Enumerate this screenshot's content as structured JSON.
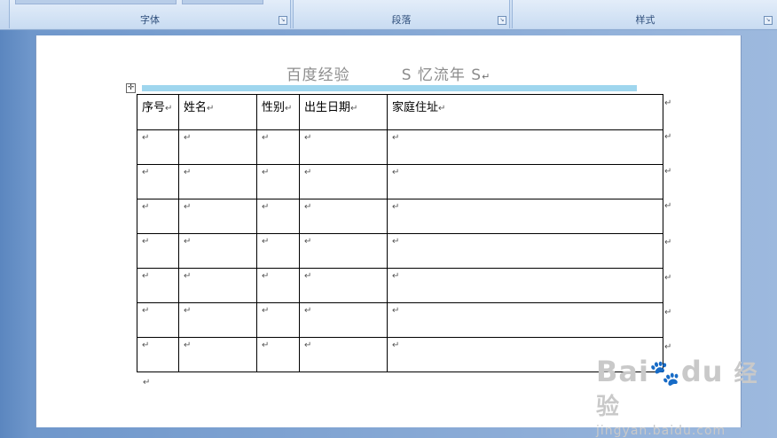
{
  "ribbon": {
    "groups": [
      {
        "label": "字体"
      },
      {
        "label": "段落"
      },
      {
        "label": "样式"
      }
    ]
  },
  "document": {
    "title_left": "百度经验",
    "title_right": "S 忆流年 S",
    "paragraph_mark": "↵",
    "table": {
      "headers": [
        "序号",
        "姓名",
        "性别",
        "出生日期",
        "家庭住址"
      ],
      "rows": 7
    }
  },
  "watermark": {
    "logo": "Bai",
    "logo_mid": "du",
    "cn": "经验",
    "url": "jingyan.baidu.com"
  }
}
